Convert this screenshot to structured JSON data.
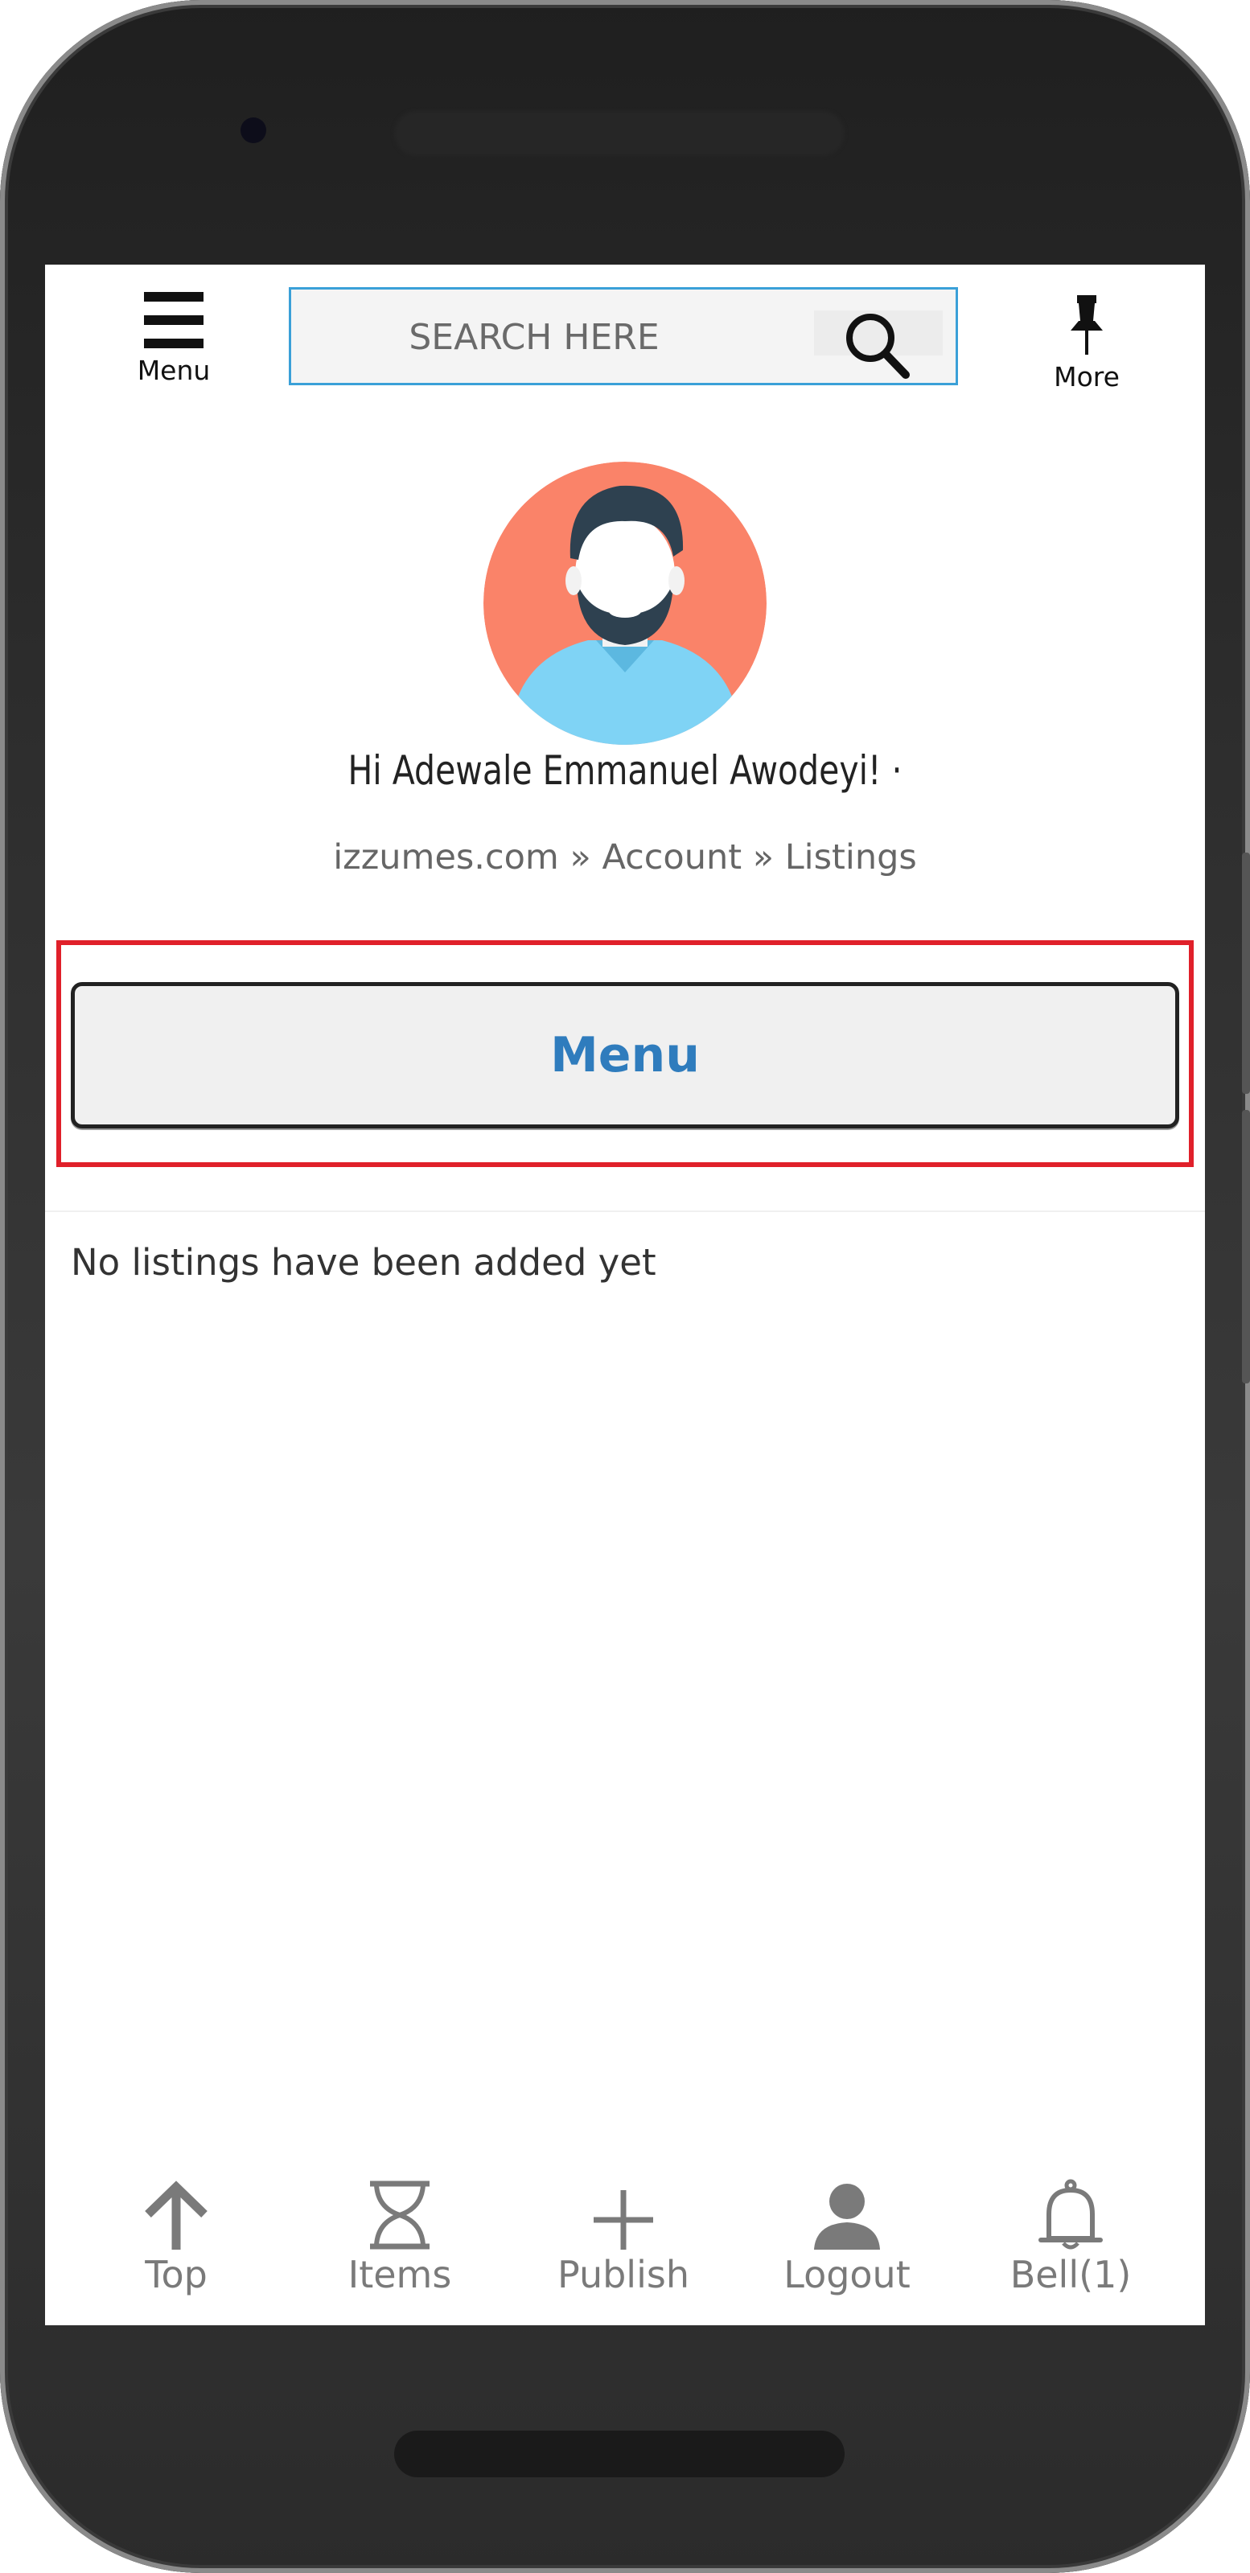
{
  "header": {
    "menu_label": "Menu",
    "search_placeholder": "SEARCH HERE",
    "more_label": "More"
  },
  "profile": {
    "greeting": "Hi Adewale Emmanuel Awodeyi! ·",
    "breadcrumb": "izzumes.com » Account » Listings"
  },
  "main": {
    "menu_button_label": "Menu",
    "empty_message": "No listings have been added yet"
  },
  "bottom_nav": {
    "items": [
      {
        "label": "Top",
        "icon": "arrow-up-icon"
      },
      {
        "label": "Items",
        "icon": "hourglass-icon"
      },
      {
        "label": "Publish",
        "icon": "plus-icon"
      },
      {
        "label": "Logout",
        "icon": "user-icon"
      },
      {
        "label": "Bell(1)",
        "icon": "bell-icon"
      }
    ]
  },
  "colors": {
    "accent": "#2f7cbd",
    "highlight": "#e0202a",
    "search_border": "#3aa0d8",
    "avatar_bg": "#fa8369",
    "nav_gray": "#7a7a7a"
  }
}
